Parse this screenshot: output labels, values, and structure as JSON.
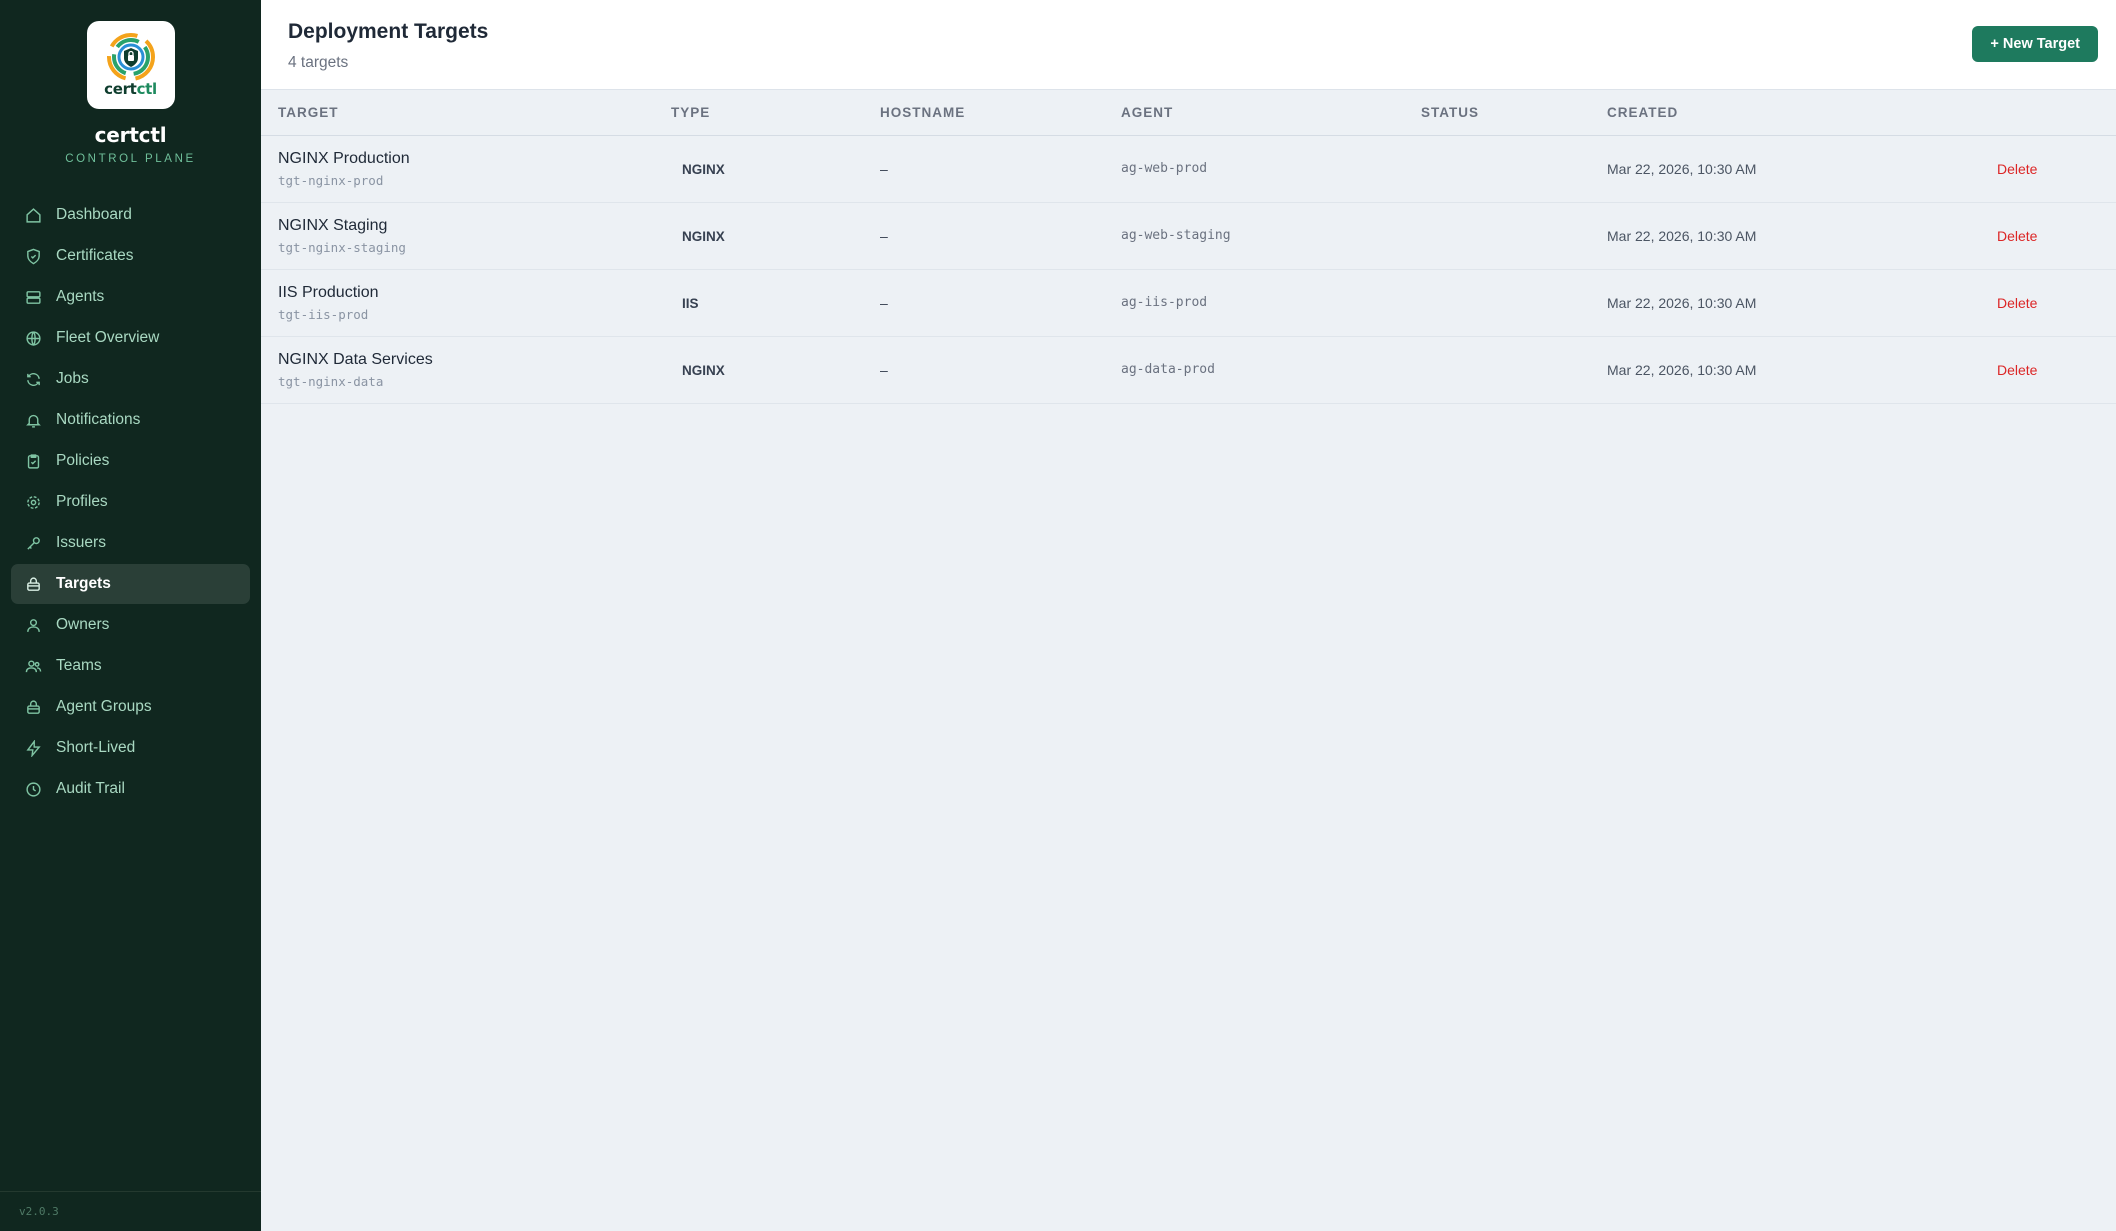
{
  "brand": {
    "logo_text_main": "cert",
    "logo_text_accent": "ctl",
    "name": "certctl",
    "subtitle": "CONTROL PLANE",
    "version": "v2.0.3",
    "colors": {
      "sidebar_bg": "#10271f",
      "accent": "#1e7a5e"
    }
  },
  "sidebar": {
    "items": [
      {
        "label": "Dashboard",
        "icon": "home-icon",
        "active": false
      },
      {
        "label": "Certificates",
        "icon": "shield-icon",
        "active": false
      },
      {
        "label": "Agents",
        "icon": "server-icon",
        "active": false
      },
      {
        "label": "Fleet Overview",
        "icon": "globe-icon",
        "active": false
      },
      {
        "label": "Jobs",
        "icon": "refresh-icon",
        "active": false
      },
      {
        "label": "Notifications",
        "icon": "bell-icon",
        "active": false
      },
      {
        "label": "Policies",
        "icon": "clipboard-check-icon",
        "active": false
      },
      {
        "label": "Profiles",
        "icon": "gear-icon",
        "active": false
      },
      {
        "label": "Issuers",
        "icon": "key-icon",
        "active": false
      },
      {
        "label": "Targets",
        "icon": "box-icon",
        "active": true
      },
      {
        "label": "Owners",
        "icon": "user-icon",
        "active": false
      },
      {
        "label": "Teams",
        "icon": "users-icon",
        "active": false
      },
      {
        "label": "Agent Groups",
        "icon": "box-icon",
        "active": false
      },
      {
        "label": "Short-Lived",
        "icon": "bolt-icon",
        "active": false
      },
      {
        "label": "Audit Trail",
        "icon": "clock-icon",
        "active": false
      }
    ]
  },
  "header": {
    "title": "Deployment Targets",
    "count": "4 targets",
    "new_button": "+ New Target"
  },
  "table": {
    "columns": [
      "TARGET",
      "TYPE",
      "HOSTNAME",
      "AGENT",
      "STATUS",
      "CREATED",
      ""
    ],
    "rows": [
      {
        "name": "NGINX Production",
        "id": "tgt-nginx-prod",
        "type": "NGINX",
        "hostname": "–",
        "agent": "ag-web-prod",
        "status": "",
        "created": "Mar 22, 2026, 10:30 AM",
        "action": "Delete"
      },
      {
        "name": "NGINX Staging",
        "id": "tgt-nginx-staging",
        "type": "NGINX",
        "hostname": "–",
        "agent": "ag-web-staging",
        "status": "",
        "created": "Mar 22, 2026, 10:30 AM",
        "action": "Delete"
      },
      {
        "name": "IIS Production",
        "id": "tgt-iis-prod",
        "type": "IIS",
        "hostname": "–",
        "agent": "ag-iis-prod",
        "status": "",
        "created": "Mar 22, 2026, 10:30 AM",
        "action": "Delete"
      },
      {
        "name": "NGINX Data Services",
        "id": "tgt-nginx-data",
        "type": "NGINX",
        "hostname": "–",
        "agent": "ag-data-prod",
        "status": "",
        "created": "Mar 22, 2026, 10:30 AM",
        "action": "Delete"
      }
    ]
  }
}
